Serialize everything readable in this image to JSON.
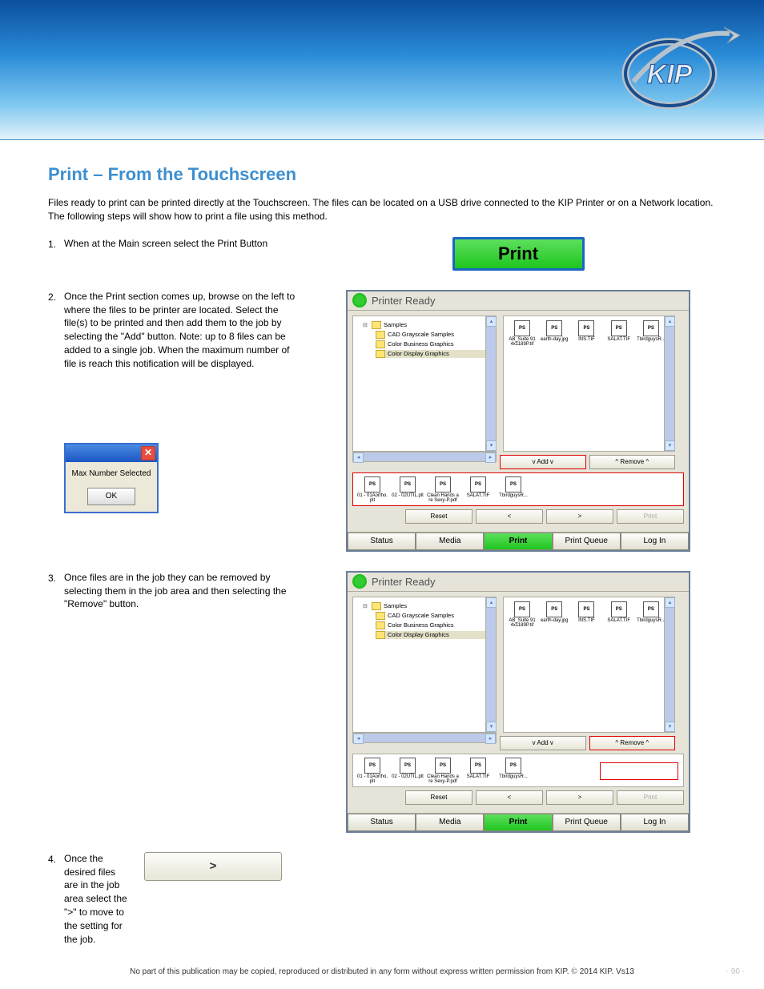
{
  "header": {
    "brand": "KIP"
  },
  "section": {
    "title": "Print – From the Touchscreen",
    "intro": "Files ready to print can be printed directly at the Touchscreen. The files can be located on a USB drive connected to the KIP Printer or on a Network location. The following steps will show how to print a file using this method.",
    "steps": [
      "When at the Main screen select the Print Button",
      "Once the Print section comes up, browse on the left to where the files to be printer are located. Select the file(s) to be printed and then add them to the job by selecting the \"Add\" button. Note: up to 8 files can be added to a single job. When the maximum number of file is reach this notification will be displayed.",
      "Once files are in the job they can be removed by selecting them in the job area and then selecting the \"Remove\" button.",
      "Once the desired files are in the job area select the \">\" to move to the setting for the job."
    ]
  },
  "print_button": {
    "label": "Print"
  },
  "panel": {
    "headtitle": "Printer Ready",
    "tree": {
      "root": "Samples",
      "children": [
        "CAD Grayscale Samples",
        "Color Business Graphics",
        "Color Display Graphics"
      ]
    },
    "thumbs": [
      "AB_Suite 914x1189P.tif",
      "earth-day.jpg",
      "INS.TIF",
      "SALAT.TIF",
      "TbirdguysR..."
    ],
    "addLabel": "v Add v",
    "removeLabel": "^ Remove ^",
    "addedThumbs": [
      "01 - 01Aortho.plt",
      "02 - 02UTIL.plt",
      "Clean Hands are Sexy-P.pdf",
      "SALAT.TIF",
      "TbirdguysR..."
    ],
    "nav": {
      "reset": "Reset",
      "back": "<",
      "fwd": ">",
      "print": "Print"
    },
    "tabs": [
      "Status",
      "Media",
      "Print",
      "Print Queue",
      "Log In"
    ]
  },
  "dialog": {
    "text": "Max Number Selected",
    "ok": "OK"
  },
  "nextBtn": ">",
  "footer": {
    "center": "No part of this publication may be copied, reproduced or distributed in any form without express written permission from KIP.  2014 KIP. Vs13",
    "right": "- 90 -"
  }
}
